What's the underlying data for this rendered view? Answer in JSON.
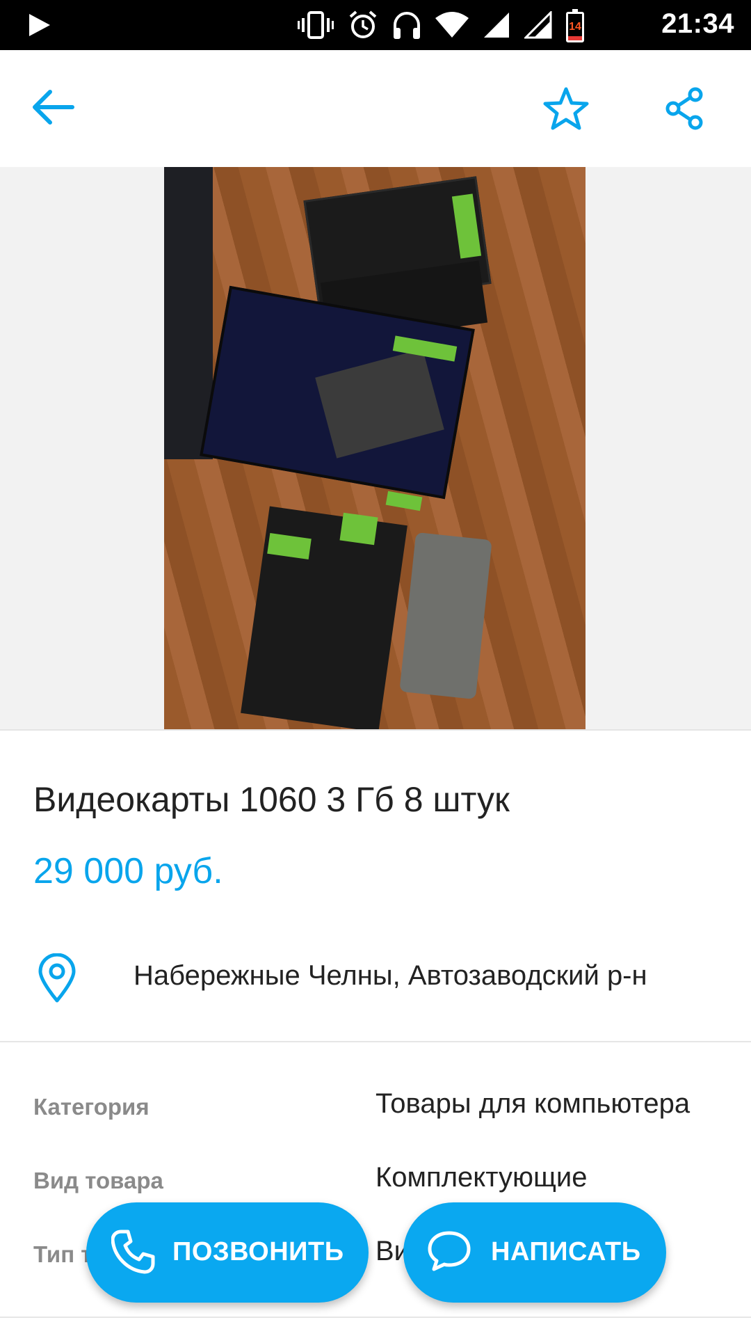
{
  "status_bar": {
    "time": "21:34",
    "battery_level": "14",
    "icons": [
      "play-icon",
      "vibrate-icon",
      "alarm-icon",
      "headset-icon",
      "wifi-icon",
      "signal-icon",
      "signal-icon-2",
      "battery-icon"
    ]
  },
  "app_bar": {
    "icons": [
      "back-arrow-icon",
      "star-outline-icon",
      "share-icon"
    ],
    "accent_color": "#09a5ec"
  },
  "listing": {
    "title": "Видеокарты 1060 3 Гб 8 штук",
    "price": "29 000 руб.",
    "location": "Набережные Челны, Автозаводский р-н",
    "params": [
      {
        "label": "Категория",
        "value": "Товары для компьютера"
      },
      {
        "label": "Вид товара",
        "value": "Комплектующие"
      },
      {
        "label": "Тип т",
        "value": "Ви"
      }
    ]
  },
  "actions": {
    "call_label": "ПОЗВОНИТЬ",
    "write_label": "НАПИСАТЬ",
    "button_color": "#0aa8f0"
  }
}
